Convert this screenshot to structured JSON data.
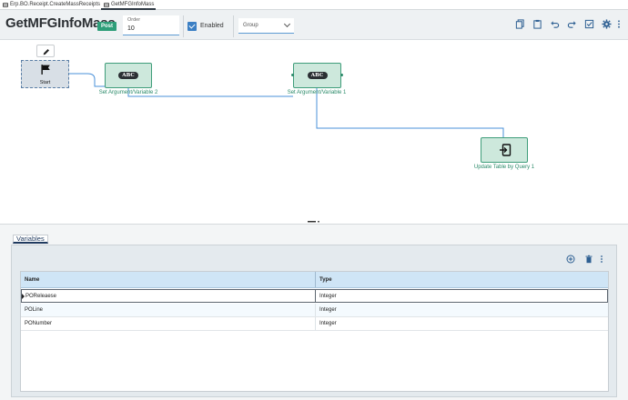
{
  "tabs": [
    {
      "label": "Erp.BO.Receipt.CreateMassReceipts",
      "active": false
    },
    {
      "label": "GetMFGInfoMass",
      "active": true
    }
  ],
  "header": {
    "title": "GetMFGInfoMass",
    "badge": "Post",
    "order_label": "Order",
    "order_value": "10",
    "enabled_label": "Enabled",
    "enabled_checked": true,
    "group_placeholder": "Group",
    "toolbar_icons": [
      "copy-icon",
      "paste-icon",
      "undo-icon",
      "redo-icon",
      "validate-icon",
      "settings-icon",
      "overflow-menu-icon"
    ]
  },
  "canvas": {
    "start_label": "Start",
    "nodes": [
      {
        "label": "Set Argument/Variable 2",
        "icon_text": "ABC"
      },
      {
        "label": "Set Argument/Variable 1",
        "icon_text": "ABC"
      },
      {
        "label": "Update Table by Query 1"
      }
    ]
  },
  "variables_panel": {
    "tab_label": "Variables",
    "icons": [
      "add-circle-icon",
      "delete-icon",
      "more-vertical-icon"
    ],
    "columns": [
      "Name",
      "Type"
    ],
    "rows": [
      {
        "name": "POReleaese",
        "type": "Integer",
        "selected": true
      },
      {
        "name": "POLine",
        "type": "Integer",
        "selected": false
      },
      {
        "name": "PONumber",
        "type": "Integer",
        "selected": false
      }
    ]
  },
  "colors": {
    "accent": "#2e9e79",
    "node_fill": "#cde8dc",
    "link": "#4a90d9",
    "header_bg": "#eef1f3",
    "grid_header": "#cfe5f6"
  }
}
